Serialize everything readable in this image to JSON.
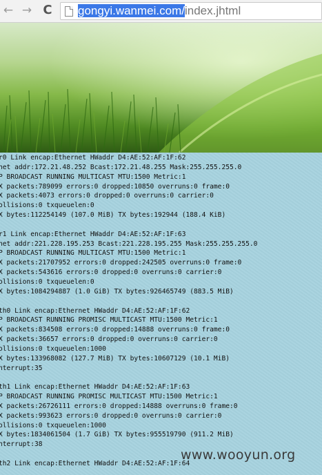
{
  "browser": {
    "back_icon": "←",
    "forward_icon": "→",
    "reload_icon": "C",
    "url_host": "gongyi.wanmei.com/",
    "url_path": "index.jhtml"
  },
  "terminal_lines": [
    "r0 Link encap:Ethernet HWaddr D4:AE:52:AF:1F:62",
    "net addr:172.21.48.252 Bcast:172.21.48.255 Mask:255.255.255.0",
    "P BROADCAST RUNNING MULTICAST MTU:1500 Metric:1",
    "X packets:789099 errors:0 dropped:10850 overruns:0 frame:0",
    "X packets:4073 errors:0 dropped:0 overruns:0 carrier:0",
    "ollisions:0 txqueuelen:0",
    "X bytes:112254149 (107.0 MiB) TX bytes:192944 (188.4 KiB)",
    "",
    "r1 Link encap:Ethernet HWaddr D4:AE:52:AF:1F:63",
    "net addr:221.228.195.253 Bcast:221.228.195.255 Mask:255.255.255.0",
    "P BROADCAST RUNNING MULTICAST MTU:1500 Metric:1",
    "X packets:21707952 errors:0 dropped:242505 overruns:0 frame:0",
    "X packets:543616 errors:0 dropped:0 overruns:0 carrier:0",
    "ollisions:0 txqueuelen:0",
    "X bytes:1084294887 (1.0 GiB) TX bytes:926465749 (883.5 MiB)",
    "",
    "th0 Link encap:Ethernet HWaddr D4:AE:52:AF:1F:62",
    "P BROADCAST RUNNING PROMISC MULTICAST MTU:1500 Metric:1",
    "X packets:834508 errors:0 dropped:14888 overruns:0 frame:0",
    "X packets:36657 errors:0 dropped:0 overruns:0 carrier:0",
    "ollisions:0 txqueuelen:1000",
    "X bytes:133968082 (127.7 MiB) TX bytes:10607129 (10.1 MiB)",
    "nterrupt:35",
    "",
    "th1 Link encap:Ethernet HWaddr D4:AE:52:AF:1F:63",
    "P BROADCAST RUNNING PROMISC MULTICAST MTU:1500 Metric:1",
    "X packets:26726111 errors:0 dropped:14888 overruns:0 frame:0",
    "X packets:993623 errors:0 dropped:0 overruns:0 carrier:0",
    "ollisions:0 txqueuelen:1000",
    "X bytes:1834061504 (1.7 GiB) TX bytes:955519790 (911.2 MiB)",
    "nterrupt:38",
    "",
    "th2 Link encap:Ethernet HWaddr D4:AE:52:AF:1F:64"
  ],
  "watermark": "www.wooyun.org"
}
